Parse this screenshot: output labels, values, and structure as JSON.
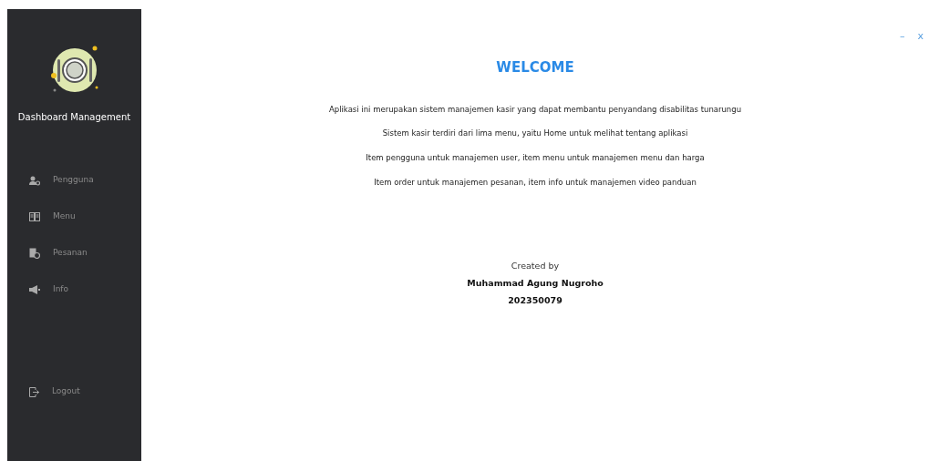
{
  "sidebar": {
    "title": "Dashboard Management",
    "items": [
      {
        "kind": "users",
        "label": "Pengguna"
      },
      {
        "kind": "menu",
        "label": "Menu"
      },
      {
        "kind": "orders",
        "label": "Pesanan"
      },
      {
        "kind": "info",
        "label": "Info"
      }
    ],
    "logout": {
      "kind": "logout",
      "label": "Logout"
    }
  },
  "window_controls": {
    "minimize": "–",
    "close": "x"
  },
  "main": {
    "title": "WELCOME",
    "paragraphs": [
      "Aplikasi ini merupakan sistem manajemen kasir yang dapat membantu penyandang disabilitas tunarungu",
      "Sistem kasir terdiri dari lima menu, yaitu Home untuk melihat tentang aplikasi",
      "Item pengguna untuk manajemen user, item menu untuk manajemen menu dan harga",
      "Item order untuk manajemen pesanan, item info untuk manajemen video panduan"
    ],
    "credit_label": "Created by",
    "author": "Muhammad Agung Nugroho",
    "student_id": "202350079"
  }
}
